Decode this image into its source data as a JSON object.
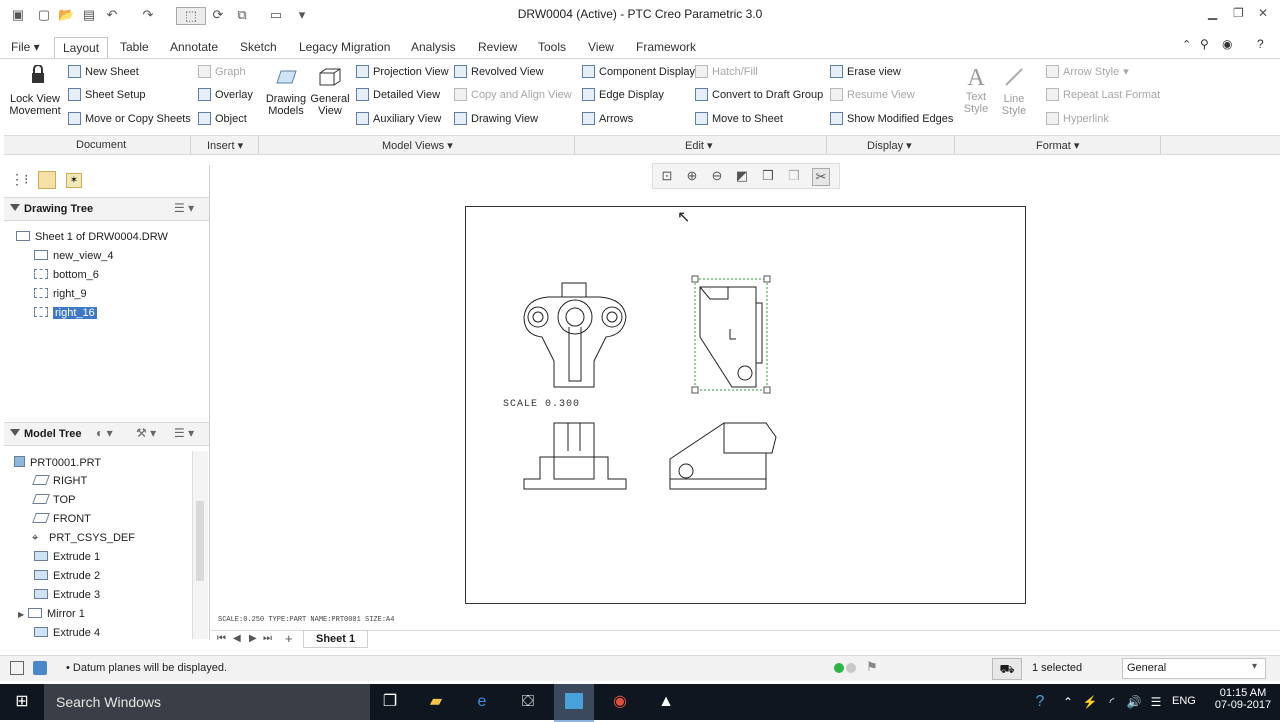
{
  "window": {
    "title": "DRW0004 (Active) - PTC Creo Parametric 3.0"
  },
  "menu": {
    "file": "File",
    "tabs": [
      "Layout",
      "Table",
      "Annotate",
      "Sketch",
      "Legacy Migration",
      "Analysis",
      "Review",
      "Tools",
      "View",
      "Framework"
    ]
  },
  "ribbon": {
    "lock_view": [
      "Lock View",
      "Movement"
    ],
    "new_sheet": "New Sheet",
    "sheet_setup": "Sheet Setup",
    "move_copy": "Move or Copy Sheets",
    "graph": "Graph",
    "overlay": "Overlay",
    "object": "Object",
    "drawing_models": [
      "Drawing",
      "Models"
    ],
    "general_view": [
      "General",
      "View"
    ],
    "projection_view": "Projection View",
    "detailed_view": "Detailed View",
    "auxiliary_view": "Auxiliary View",
    "revolved_view": "Revolved View",
    "copy_align": "Copy and Align View",
    "drawing_view": "Drawing View",
    "component_display": "Component Display",
    "edge_display": "Edge Display",
    "arrows": "Arrows",
    "hatch_fill": "Hatch/Fill",
    "convert_draft": "Convert to Draft Group",
    "move_sheet": "Move to Sheet",
    "erase_view": "Erase view",
    "resume_view": "Resume View",
    "show_modified": "Show Modified Edges",
    "text_style": [
      "Text",
      "Style"
    ],
    "line_style": [
      "Line",
      "Style"
    ],
    "arrow_style": "Arrow Style",
    "repeat_format": "Repeat Last Format",
    "hyperlink": "Hyperlink",
    "groups": [
      "Document",
      "Insert",
      "Model Views",
      "Edit",
      "Display",
      "Format"
    ]
  },
  "drawing_tree": {
    "title": "Drawing Tree",
    "items": [
      "Sheet 1 of DRW0004.DRW",
      "new_view_4",
      "bottom_6",
      "right_9",
      "right_16"
    ],
    "selected_index": 4
  },
  "model_tree": {
    "title": "Model Tree",
    "items": [
      "PRT0001.PRT",
      "RIGHT",
      "TOP",
      "FRONT",
      "PRT_CSYS_DEF",
      "Extrude 1",
      "Extrude 2",
      "Extrude 3",
      "Mirror 1",
      "Extrude 4"
    ]
  },
  "sheet": {
    "scale_label": "SCALE  0.300",
    "footer": "SCALE:0.250    TYPE:PART    NAME:PRT0001    SIZE:A4",
    "tab": "Sheet 1"
  },
  "status": {
    "message": "Datum planes will be displayed.",
    "selected": "1 selected",
    "filter": "General"
  },
  "taskbar": {
    "search": "Search Windows",
    "lang": "ENG",
    "time": "01:15 AM",
    "date": "07-09-2017"
  },
  "colors": {
    "accent": "#3f78c7",
    "taskbar": "#0f1620"
  }
}
